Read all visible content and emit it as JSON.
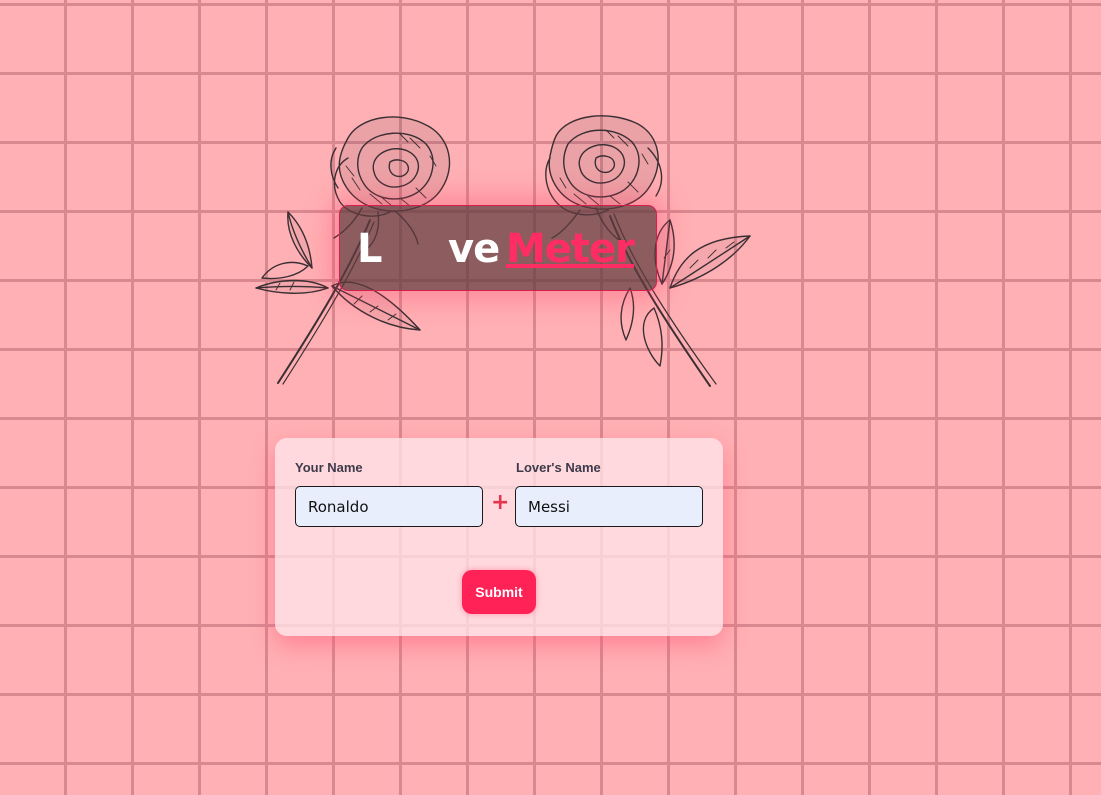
{
  "title": {
    "letter_l": "L",
    "letters_ve": "ve",
    "meter": "Meter",
    "accent_color": "#ff2d63"
  },
  "form": {
    "your_name_label": "Your Name",
    "your_name_value": "Ronaldo",
    "lover_name_label": "Lover's Name",
    "lover_name_value": "Messi",
    "plus": "+",
    "submit_label": "Submit",
    "submit_color": "#ff2257"
  },
  "decoration": {
    "left_icon": "rose-icon",
    "right_icon": "rose-icon"
  }
}
